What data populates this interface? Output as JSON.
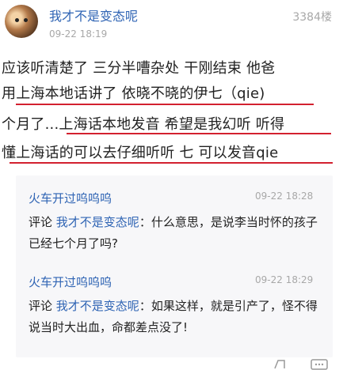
{
  "post": {
    "username": "我才不是变态呢",
    "time": "09-22 18:19",
    "floor": "3384楼",
    "lines": [
      "应该听清楚了 三分半嘈杂处 干刚结束 他爸",
      "用上海本地话讲了 依晓不晓的伊七（qie)",
      "个月了...上海话本地发音 希望是我幻听 听得",
      "懂上海话的可以去仔细听听 七 可以发音qie"
    ]
  },
  "comments": [
    {
      "name": "火车开过呜呜呜",
      "time": "09-22 18:28",
      "prefix": "评论",
      "mention": "我才不是变态呢",
      "text": "：什么意思，是说李当时怀的孩子已经七个月了吗?"
    },
    {
      "name": "火车开过呜呜呜",
      "time": "09-22 18:29",
      "prefix": "评论",
      "mention": "我才不是变态呢",
      "text": "：如果这样，就是引产了，怪不得说当时大出血，命都差点没了!"
    }
  ],
  "icons": [
    "avatar",
    "reply-icon",
    "more-icon"
  ],
  "colors": {
    "link": "#2f64b4",
    "underline": "#d3212f",
    "meta": "#a8a8a8"
  }
}
